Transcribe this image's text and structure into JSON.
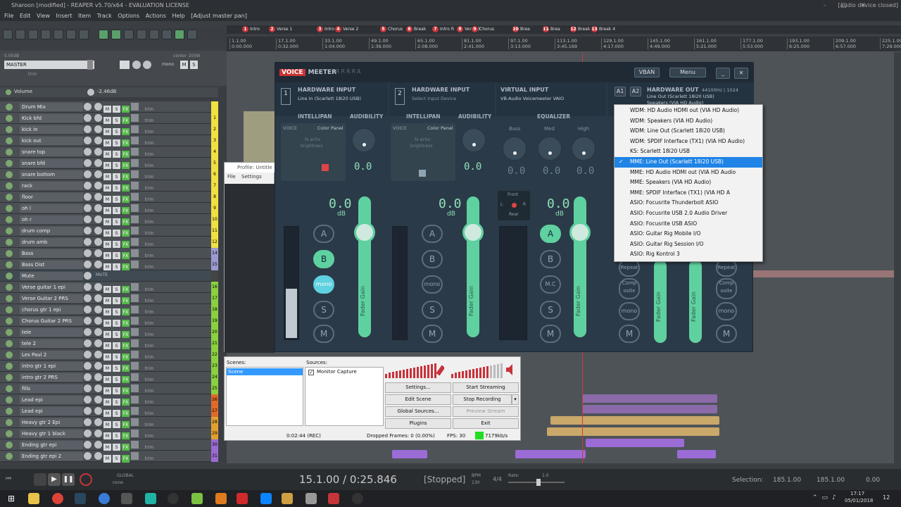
{
  "window": {
    "title": "Sharoon [modified] - REAPER v5.70/x64 - EVALUATION LICENSE",
    "status_right": "[audio device closed]"
  },
  "menu": [
    "File",
    "Edit",
    "View",
    "Insert",
    "Item",
    "Track",
    "Options",
    "Actions",
    "Help",
    "[Adjust master pan]"
  ],
  "markers": [
    {
      "n": "1",
      "label": "Intro"
    },
    {
      "n": "2",
      "label": "Verse 1"
    },
    {
      "n": "3",
      "label": "Intro R"
    },
    {
      "n": "4",
      "label": "Verse 2"
    },
    {
      "n": "5",
      "label": "Chorus"
    },
    {
      "n": "6",
      "label": "Break"
    },
    {
      "n": "7",
      "label": "Intro R"
    },
    {
      "n": "8",
      "label": "Verse 3"
    },
    {
      "n": "9",
      "label": "Chorus"
    },
    {
      "n": "10",
      "label": "Brea"
    },
    {
      "n": "11",
      "label": "Brea"
    },
    {
      "n": "12",
      "label": "Break"
    },
    {
      "n": "13",
      "label": "Break 4"
    }
  ],
  "ruler": [
    {
      "bar": "1.1.00",
      "time": "0:00.000"
    },
    {
      "bar": "17.1.00",
      "time": "0:32.000"
    },
    {
      "bar": "33.1.00",
      "time": "1:04.000"
    },
    {
      "bar": "49.1.00",
      "time": "1:36.000"
    },
    {
      "bar": "65.1.00",
      "time": "2:08.000"
    },
    {
      "bar": "81.1.00",
      "time": "2:41.000"
    },
    {
      "bar": "97.1.00",
      "time": "3:13.000"
    },
    {
      "bar": "113.1.00",
      "time": "3:45.169"
    },
    {
      "bar": "129.1.00",
      "time": "4:17.000"
    },
    {
      "bar": "145.1.00",
      "time": "4:49.000"
    },
    {
      "bar": "161.1.00",
      "time": "5:21.000"
    },
    {
      "bar": "177.1.00",
      "time": "5:53.000"
    },
    {
      "bar": "193.1.00",
      "time": "6:25.000"
    },
    {
      "bar": "209.1.00",
      "time": "6:57.000"
    },
    {
      "bar": "225.1.00",
      "time": "7:29.000"
    }
  ],
  "master": {
    "name": "MASTER",
    "db": "0.00dB",
    "center": "center 100W",
    "trim": "trim",
    "mono": "mono"
  },
  "volume_env": {
    "label": "Volume",
    "value": "-2.46dB"
  },
  "tracks": [
    {
      "name": "Drum Mix",
      "num": ""
    },
    {
      "name": "Kick bfd",
      "num": "1"
    },
    {
      "name": "kick in",
      "num": "2"
    },
    {
      "name": "kick out",
      "num": "3"
    },
    {
      "name": "snare top",
      "num": "4"
    },
    {
      "name": "snare bfd",
      "num": "5"
    },
    {
      "name": "snare bottom",
      "num": "6"
    },
    {
      "name": "rack",
      "num": "7"
    },
    {
      "name": "floor",
      "num": "8"
    },
    {
      "name": "oh l",
      "num": "9"
    },
    {
      "name": "oh r",
      "num": "10"
    },
    {
      "name": "drum comp",
      "num": "11"
    },
    {
      "name": "drum amb",
      "num": "12"
    },
    {
      "name": "Bass",
      "num": "14"
    },
    {
      "name": "Bass Dist",
      "num": "15"
    },
    {
      "name": "Mute",
      "num": ""
    },
    {
      "name": "Verse guitar 1 epi",
      "num": "16"
    },
    {
      "name": "Verse Guitar 2 PRS",
      "num": "17"
    },
    {
      "name": "chorus gtr 1 epi",
      "num": "18"
    },
    {
      "name": "Chorus Guitar 2 PRS",
      "num": "19"
    },
    {
      "name": "tele",
      "num": "20"
    },
    {
      "name": "tele 2",
      "num": "21"
    },
    {
      "name": "Les Paul 2",
      "num": "22"
    },
    {
      "name": "intro gtr 1 epi",
      "num": "23"
    },
    {
      "name": "intro gtr 2 PRS",
      "num": "24"
    },
    {
      "name": "fills",
      "num": "25"
    },
    {
      "name": "Lead epi",
      "num": "26"
    },
    {
      "name": "Lead epi",
      "num": "27"
    },
    {
      "name": "Heavy gtr 2 Epi",
      "num": "28"
    },
    {
      "name": "Heavy gtr 1 black",
      "num": "29"
    },
    {
      "name": "Ending gtr epi",
      "num": "30"
    },
    {
      "name": "Ending gtr epi 2",
      "num": "31"
    }
  ],
  "track_btn": {
    "m": "M",
    "s": "S",
    "fx": "FX",
    "trim": "trim",
    "route": "route"
  },
  "mute_label": "MUTE",
  "voicemeeter": {
    "brand_a": "VOICE",
    "brand_b": "MEETER",
    "badges": "RRRRA",
    "vban": "VBAN",
    "menu": "Menu",
    "in1": {
      "n": "1",
      "title": "HARDWARE INPUT",
      "sub": "Line In (Scarlett 18i20 USB)"
    },
    "in2": {
      "n": "2",
      "title": "HARDWARE INPUT",
      "sub": "Select Input Device"
    },
    "vin": {
      "title": "VIRTUAL INPUT",
      "sub": "VB-Audio Voicemeeter VAIO"
    },
    "hwout": {
      "a1": "A1",
      "a2": "A2",
      "title": "HARDWARE OUT",
      "rate": "44100Hz | 1024",
      "sub": "Line Out (Scarlett 18i20 USB)",
      "sub2": "Speakers (VIA HD Audio)"
    },
    "intellipan": "INTELLIPAN",
    "audibility": "AUDIBILITY",
    "equalizer": "EQUALIZER",
    "voice": "VOICE",
    "color_panel": "Color Panel",
    "fx_echo": "fx echo",
    "brightness": "brightness",
    "lo": "Lo",
    "hi": "Hi",
    "bass": "Bass",
    "med": "Med",
    "high": "High",
    "db": "dB",
    "zero": "0.0",
    "btn_a": "A",
    "btn_b": "B",
    "btn_mono": "mono",
    "btn_s": "S",
    "btn_m": "M",
    "btn_mc": "M.C",
    "fader": "Fader Gain",
    "repeat": "Repeat",
    "composite": "Comp osite",
    "front": "Front",
    "rear": "Rear",
    "l": "L",
    "r": "R"
  },
  "device_menu": [
    {
      "label": "WDM: HD Audio HDMI out (VIA HD Audio)",
      "selected": false
    },
    {
      "label": "WDM: Speakers (VIA HD Audio)",
      "selected": false
    },
    {
      "label": "WDM: Line Out (Scarlett 18i20 USB)",
      "selected": false
    },
    {
      "label": "WDM: SPDIF Interface (TX1) (VIA HD Audio)",
      "selected": false
    },
    {
      "label": "KS: Scarlett 18i20 USB",
      "selected": false
    },
    {
      "label": "MME: Line Out (Scarlett 18i20 USB)",
      "selected": true
    },
    {
      "label": "MME: HD Audio HDMI out (VIA HD Audio",
      "selected": false
    },
    {
      "label": "MME: Speakers (VIA HD Audio)",
      "selected": false
    },
    {
      "label": "MME: SPDIF Interface (TX1) (VIA HD A",
      "selected": false
    },
    {
      "label": "ASIO: Focusrite Thunderbolt ASIO",
      "selected": false
    },
    {
      "label": "ASIO: Focusrite USB 2.0 Audio Driver",
      "selected": false
    },
    {
      "label": "ASIO: Focusrite USB ASIO",
      "selected": false
    },
    {
      "label": "ASIO: Guitar Rig Mobile I/O",
      "selected": false
    },
    {
      "label": "ASIO: Guitar Rig Session I/O",
      "selected": false
    },
    {
      "label": "ASIO: Rig Kontrol 3",
      "selected": false
    }
  ],
  "obs": {
    "profile_title": "Profile: Untitle",
    "file": "File",
    "settings": "Settings",
    "plugins_short": "Pl",
    "scenes": "Scenes:",
    "scene_item": "Scene",
    "sources": "Sources:",
    "source_item": "Monitor Capture",
    "btn_settings": "Settings...",
    "btn_start_streaming": "Start Streaming",
    "btn_edit_scene": "Edit Scene",
    "btn_stop_recording": "Stop Recording",
    "btn_global_sources": "Global Sources...",
    "btn_preview_stream": "Preview Stream",
    "btn_plugins": "Plugins",
    "btn_exit": "Exit",
    "time": "0:02:44 (REC)",
    "dropped": "Dropped Frames: 0 (0.00%)",
    "fps": "FPS: 30",
    "bitrate": "7179kb/s"
  },
  "transport": {
    "position": "15.1.00 / 0:25.846",
    "state": "[Stopped]",
    "bpm_label": "BPM",
    "bpm": "130",
    "sig": "4/4",
    "rate_label": "Rate:",
    "rate": "1.0",
    "selection_label": "Selection:",
    "sel_start": "185.1.00",
    "sel_end": "185.1.00",
    "sel_len": "0.00",
    "global": "GLOBAL",
    "none": "none"
  },
  "clock": {
    "time": "17:17",
    "date": "05/01/2018",
    "notif": "12"
  },
  "colors": {
    "accent": "#5fd1a0",
    "vm_bg": "#2b3a48",
    "selection": "#1f84e6",
    "record_red": "#c5353a"
  }
}
